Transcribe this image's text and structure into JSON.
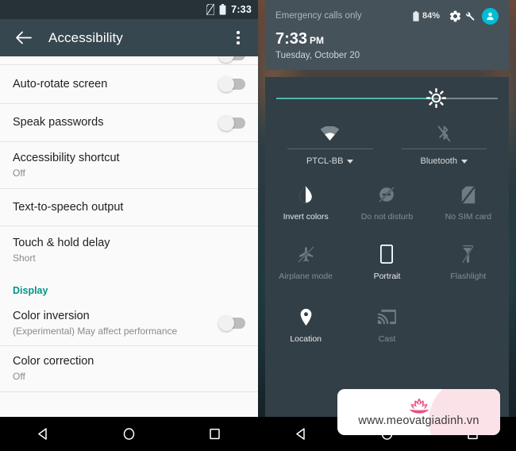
{
  "left_panel": {
    "status_bar": {
      "time": "7:33",
      "icons": [
        "no-sim-icon",
        "battery-icon"
      ]
    },
    "app_bar": {
      "back_icon": "back-arrow-icon",
      "title": "Accessibility",
      "overflow_icon": "overflow-menu-icon"
    },
    "rows": [
      {
        "title": "Auto-rotate screen",
        "subtitle": "",
        "control": "toggle-off"
      },
      {
        "title": "Speak passwords",
        "subtitle": "",
        "control": "toggle-off"
      },
      {
        "title": "Accessibility shortcut",
        "subtitle": "Off",
        "control": "none"
      },
      {
        "title": "Text-to-speech output",
        "subtitle": "",
        "control": "none"
      },
      {
        "title": "Touch & hold delay",
        "subtitle": "Short",
        "control": "none"
      }
    ],
    "section_header": "Display",
    "display_rows": [
      {
        "title": "Color inversion",
        "subtitle": "(Experimental) May affect performance",
        "control": "toggle-off"
      },
      {
        "title": "Color correction",
        "subtitle": "Off",
        "control": "none"
      }
    ],
    "nav_bar": {
      "back": "back-triangle-icon",
      "home": "home-circle-icon",
      "recents": "recents-square-icon"
    }
  },
  "right_panel": {
    "header": {
      "carrier": "Emergency calls only",
      "battery_percent": "84%",
      "battery_icon": "battery-icon",
      "settings_icon": "gear-icon",
      "wrench_icon": "wrench-icon",
      "avatar_icon": "user-avatar-icon",
      "time": "7:33",
      "am_pm": "PM",
      "date": "Tuesday, October 20"
    },
    "brightness": {
      "icon": "brightness-sun-icon",
      "value_percent": 72
    },
    "connectivity": [
      {
        "label": "PTCL-BB",
        "icon": "wifi-icon",
        "state": "on",
        "has_caret": true
      },
      {
        "label": "Bluetooth",
        "icon": "bluetooth-disabled-icon",
        "state": "off",
        "has_caret": true
      }
    ],
    "tiles": [
      [
        {
          "label": "Invert colors",
          "icon": "invert-colors-icon",
          "state": "on"
        },
        {
          "label": "Do not disturb",
          "icon": "do-not-disturb-icon",
          "state": "off"
        },
        {
          "label": "No SIM card",
          "icon": "no-sim-card-icon",
          "state": "off"
        }
      ],
      [
        {
          "label": "Airplane mode",
          "icon": "airplane-icon",
          "state": "off"
        },
        {
          "label": "Portrait",
          "icon": "portrait-icon",
          "state": "on"
        },
        {
          "label": "Flashlight",
          "icon": "flashlight-icon",
          "state": "off"
        }
      ],
      [
        {
          "label": "Location",
          "icon": "location-pin-icon",
          "state": "on"
        },
        {
          "label": "Cast",
          "icon": "cast-icon",
          "state": "off"
        }
      ]
    ],
    "nav_bar": {
      "back": "back-triangle-icon",
      "home": "home-circle-icon",
      "recents": "recents-square-icon"
    }
  },
  "watermark": {
    "text": "www.meovatgiadinh.vn",
    "logo": "lotus-flower-icon"
  },
  "colors": {
    "accent_teal": "#009688",
    "slider_teal": "#4DB6AC",
    "avatar_cyan": "#00BCD4",
    "appbar": "#37474F",
    "statusbar": "#263238",
    "shade_header": "#46525A",
    "shade_body": "#333F46",
    "watermark_pink": "#E8467C"
  }
}
